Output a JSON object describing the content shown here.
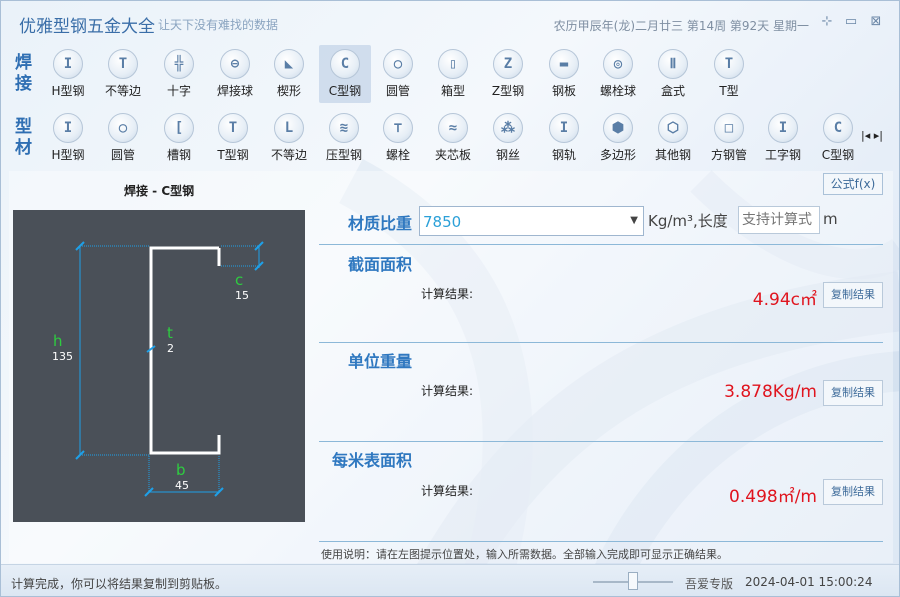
{
  "app": {
    "title": "优雅型钢五金大全",
    "subtitle": "让天下没有难找的数据",
    "date_info": "农历甲辰年(龙)二月廿三 第14周 第92天 星期一"
  },
  "window_controls": {
    "pin": "⊹",
    "minimize": "▭",
    "close": "⊠"
  },
  "weld_row": {
    "label": "焊接",
    "items": [
      {
        "label": "H型钢",
        "glyph": "I"
      },
      {
        "label": "不等边",
        "glyph": "T"
      },
      {
        "label": "十字",
        "glyph": "╬"
      },
      {
        "label": "焊接球",
        "glyph": "⊖"
      },
      {
        "label": "楔形",
        "glyph": "◣"
      },
      {
        "label": "C型钢",
        "glyph": "C"
      },
      {
        "label": "圆管",
        "glyph": "○"
      },
      {
        "label": "箱型",
        "glyph": "▯"
      },
      {
        "label": "Z型钢",
        "glyph": "Z"
      },
      {
        "label": "钢板",
        "glyph": "▬"
      },
      {
        "label": "螺栓球",
        "glyph": "◎"
      },
      {
        "label": "盒式",
        "glyph": "Ⅱ"
      },
      {
        "label": "T型",
        "glyph": "T"
      }
    ]
  },
  "profile_row": {
    "label": "型材",
    "items": [
      {
        "label": "H型钢",
        "glyph": "I"
      },
      {
        "label": "圆管",
        "glyph": "○"
      },
      {
        "label": "槽钢",
        "glyph": "["
      },
      {
        "label": "T型钢",
        "glyph": "T"
      },
      {
        "label": "不等边",
        "glyph": "L"
      },
      {
        "label": "压型钢",
        "glyph": "≋"
      },
      {
        "label": "螺栓",
        "glyph": "⊤"
      },
      {
        "label": "夹芯板",
        "glyph": "≈"
      },
      {
        "label": "钢丝",
        "glyph": "⁂"
      },
      {
        "label": "钢轨",
        "glyph": "I"
      },
      {
        "label": "多边形",
        "glyph": "⬢"
      },
      {
        "label": "其他钢",
        "glyph": "⬡"
      },
      {
        "label": "方钢管",
        "glyph": "□"
      },
      {
        "label": "工字钢",
        "glyph": "I"
      },
      {
        "label": "C型钢",
        "glyph": "C"
      }
    ]
  },
  "nav_arrows": "|◂ ▸|",
  "diagram": {
    "title": "焊接 - C型钢",
    "h_label": "h",
    "h_value": "135",
    "c_label": "c",
    "c_value": "15",
    "t_label": "t",
    "t_value": "2",
    "b_label": "b",
    "b_value": "45"
  },
  "formula_button": "公式f(x)",
  "material": {
    "label": "材质比重",
    "value": "7850",
    "unit_length": "Kg/m³,长度",
    "length_placeholder": "支持计算式",
    "length_unit": "m"
  },
  "sections": [
    {
      "title": "截面面积",
      "calc_label": "计算结果:",
      "result": "4.94c㎡",
      "copy": "复制结果"
    },
    {
      "title": "单位重量",
      "calc_label": "计算结果:",
      "result": "3.878Kg/m",
      "copy": "复制结果"
    },
    {
      "title": "每米表面积",
      "calc_label": "计算结果:",
      "result": "0.498㎡/m",
      "copy": "复制结果"
    }
  ],
  "usage_text": "使用说明：请在左图提示位置处，输入所需数据。全部输入完成即可显示正确结果。",
  "status": {
    "message": "计算完成，你可以将结果复制到剪贴板。",
    "edition": "吾爱专版",
    "datetime": "2024-04-01 15:00:24"
  },
  "colors": {
    "accent": "#2f78c0",
    "result": "#e0141e",
    "dimension_value": "#ffffff",
    "dimension_label": "#2ecc40",
    "diagram_bg": "#4a5058",
    "dimension_line": "#1ea0e8"
  }
}
